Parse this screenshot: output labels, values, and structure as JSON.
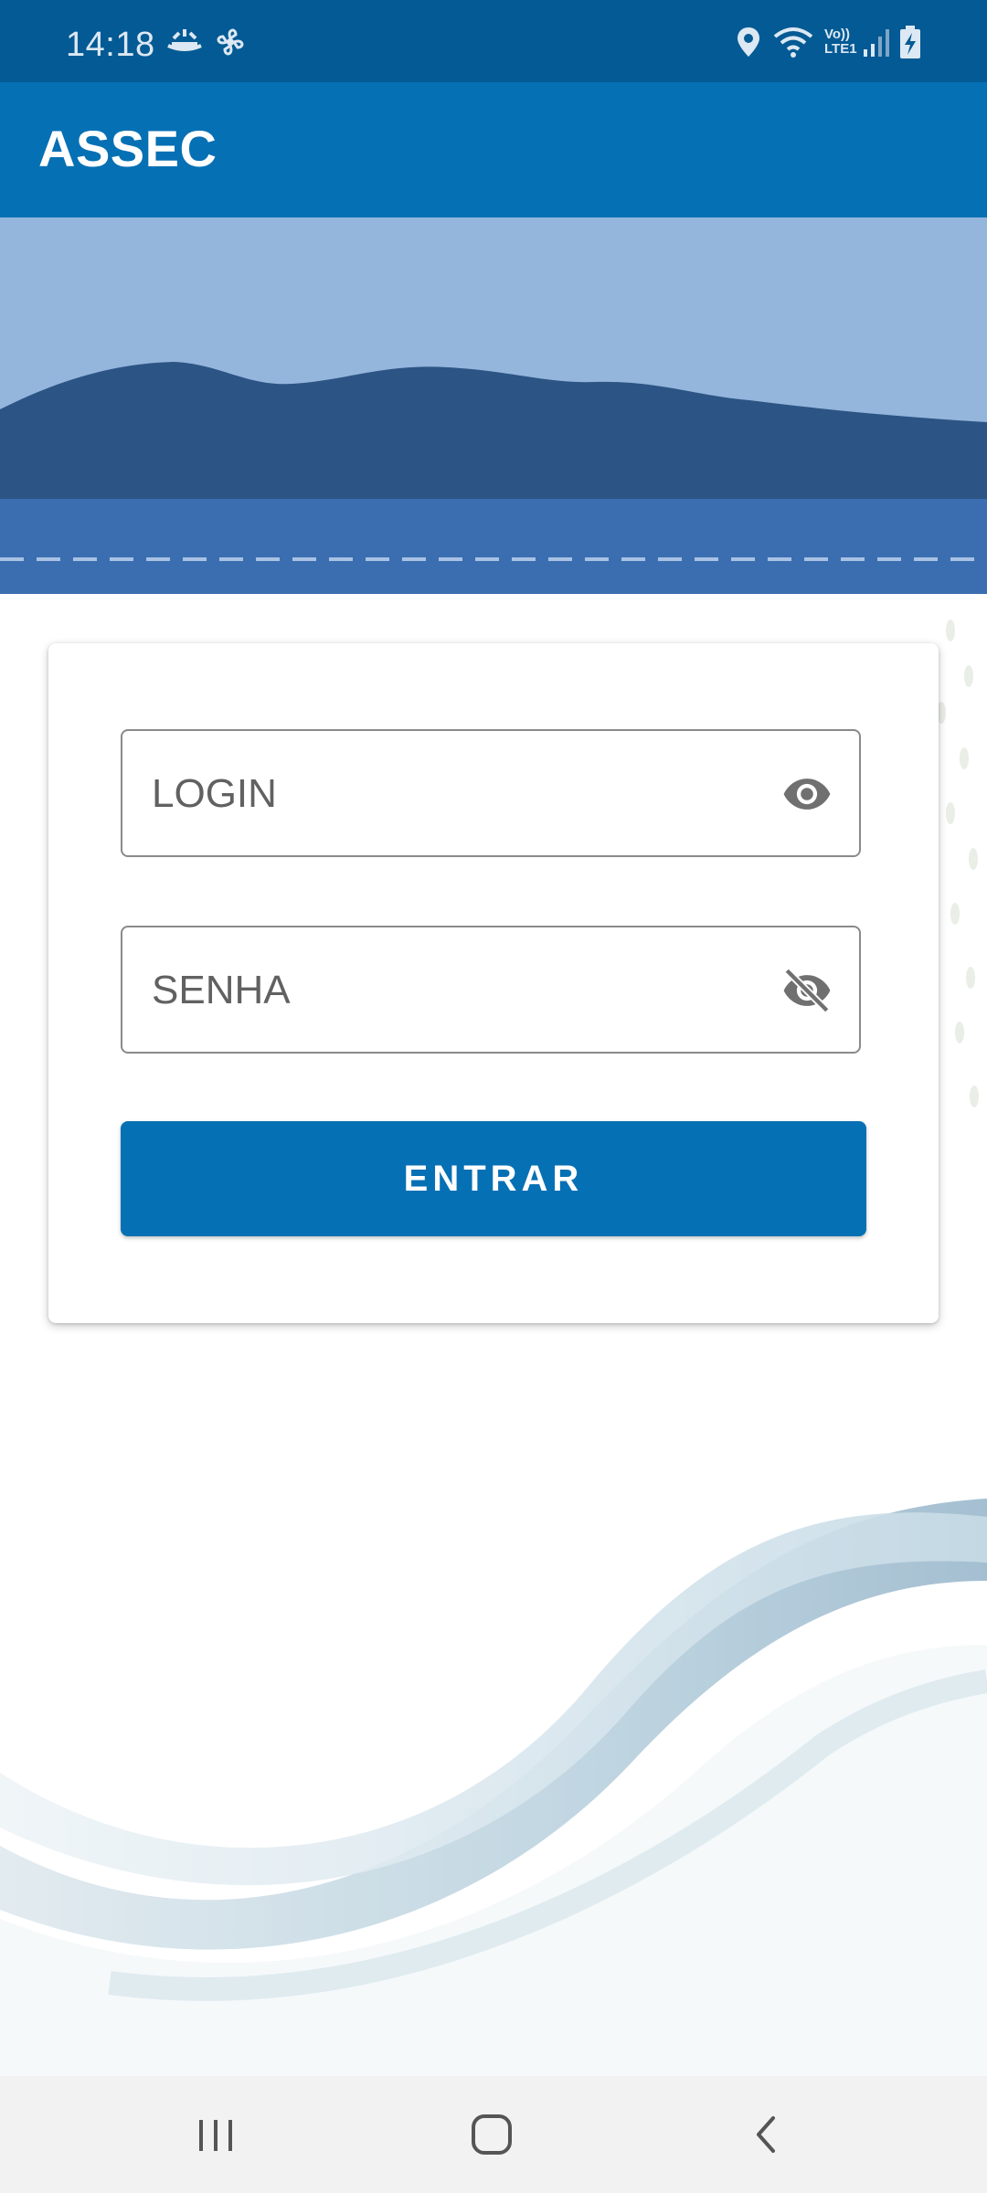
{
  "status_bar": {
    "time": "14:18",
    "network_label_top": "Vo))",
    "network_label_bottom": "LTE1"
  },
  "app_bar": {
    "title": "ASSEC"
  },
  "login_form": {
    "login_placeholder": "LOGIN",
    "password_placeholder": "SENHA",
    "submit_label": "ENTRAR"
  },
  "colors": {
    "primary": "#0670b4",
    "status_bar": "#035a94",
    "banner_sky": "#94b5dc",
    "banner_hills": "#2c5585",
    "banner_water": "#3a6eb0"
  },
  "icons": {
    "login_visibility": "eye-icon",
    "password_visibility": "eye-off-icon",
    "nav_recent": "recent-apps-icon",
    "nav_home": "home-icon",
    "nav_back": "back-icon"
  }
}
